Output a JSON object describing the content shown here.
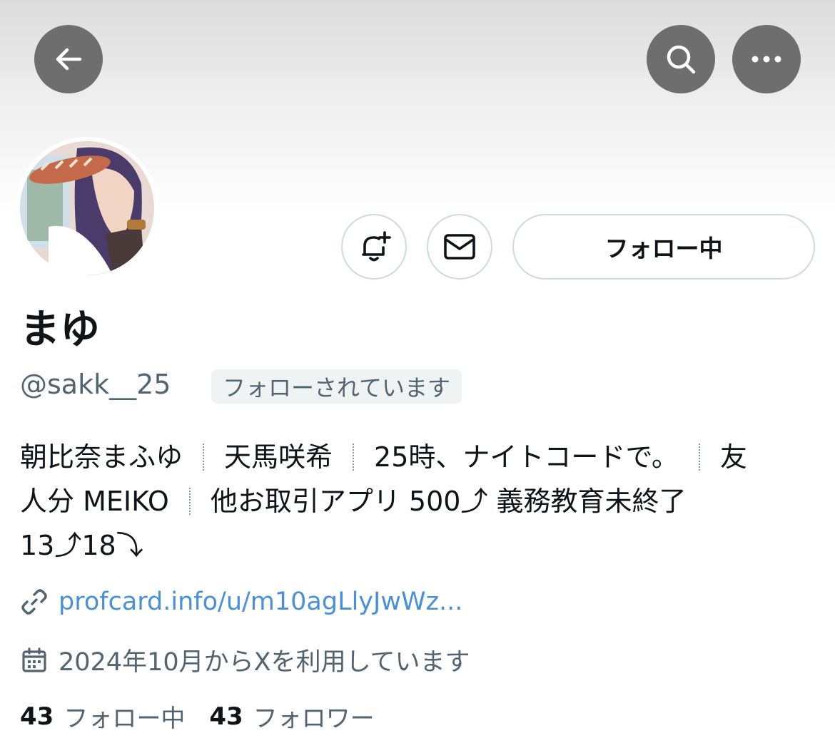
{
  "profile": {
    "display_name": "まゆ",
    "handle": "@sakk__25",
    "follows_you": "フォローされています",
    "bio": {
      "line1": [
        "朝比奈まふゆ",
        "天馬咲希",
        "25時、ナイトコードで。",
        "友"
      ],
      "line2": [
        "人分 MEIKO",
        "他お取引アプリ 500⤴ 義務教育未終了"
      ],
      "line3": "13⤴18⤵"
    },
    "link": "profcard.info/u/m10agLlyJwWz...",
    "joined": "2024年10月からXを利用しています",
    "following_count": "43",
    "following_label": "フォロー中",
    "followers_count": "43",
    "followers_label": "フォロワー"
  },
  "actions": {
    "follow_label": "フォロー中",
    "back_icon": "back-arrow-icon",
    "search_icon": "search-icon",
    "more_icon": "more-icon",
    "notify_icon": "bell-plus-icon",
    "message_icon": "envelope-icon"
  },
  "colors": {
    "link": "#4a90d9",
    "secondary_text": "#536471",
    "button_overlay": "#6e6e6e",
    "border": "#cfd9de"
  }
}
